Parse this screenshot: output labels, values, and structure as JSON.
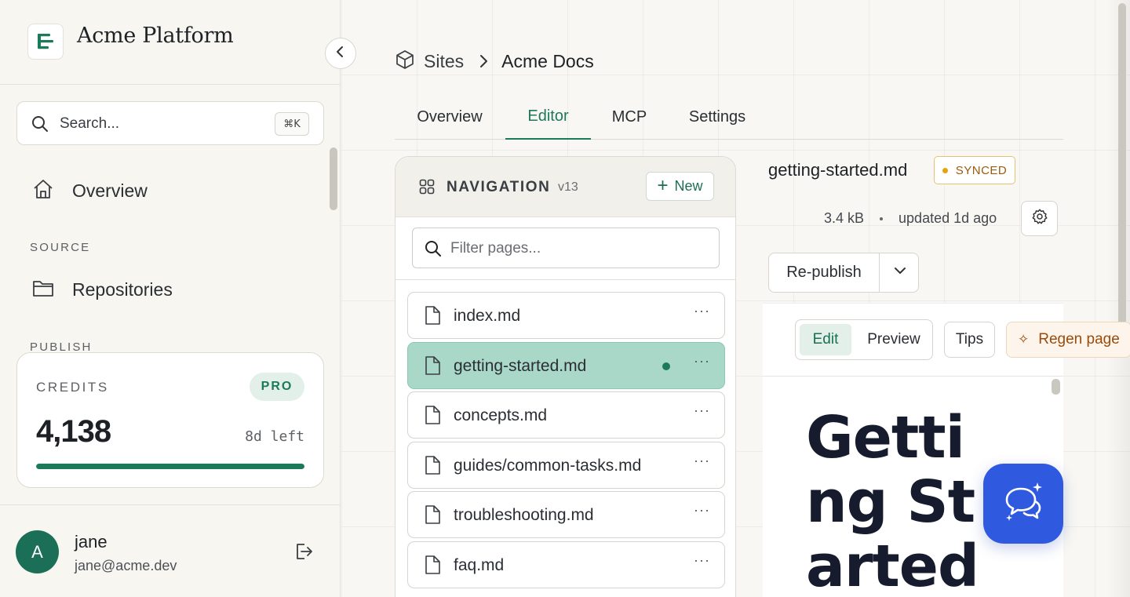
{
  "brand": {
    "title": "Acme Platform"
  },
  "sidebar": {
    "search": {
      "placeholder": "Search...",
      "shortcut": "⌘K"
    },
    "items": [
      {
        "label": "Overview",
        "icon": "home-icon"
      },
      {
        "label": "Repositories",
        "icon": "folder-icon"
      }
    ],
    "sections": {
      "source": "SOURCE",
      "publish": "PUBLISH"
    },
    "credits": {
      "label": "CREDITS",
      "plan": "PRO",
      "amount": "4,138",
      "remaining": "8d left",
      "progress": 1.0
    },
    "user": {
      "initial": "A",
      "name": "jane",
      "email": "jane@acme.dev"
    }
  },
  "breadcrumb": {
    "parent": "Sites",
    "current": "Acme Docs"
  },
  "tabs": [
    {
      "label": "Overview"
    },
    {
      "label": "Editor",
      "active": true
    },
    {
      "label": "MCP"
    },
    {
      "label": "Settings"
    }
  ],
  "navigation": {
    "title": "NAVIGATION",
    "version": "v13",
    "new_label": "New",
    "filter_placeholder": "Filter pages...",
    "files": [
      {
        "name": "index.md"
      },
      {
        "name": "getting-started.md",
        "active": true,
        "modified": true
      },
      {
        "name": "concepts.md"
      },
      {
        "name": "guides/common-tasks.md"
      },
      {
        "name": "troubleshooting.md"
      },
      {
        "name": "faq.md"
      }
    ]
  },
  "document": {
    "name": "getting-started.md",
    "status": "SYNCED",
    "size": "3.4 kB",
    "updated": "updated 1d ago",
    "republish_label": "Re-publish",
    "toolbar": {
      "edit": "Edit",
      "preview": "Preview",
      "tips": "Tips",
      "regen": "Regen page"
    },
    "heading": "Getting Started"
  },
  "colors": {
    "accent": "#1b7a5a",
    "active_row": "#a9d8c8",
    "synced": "#e6a40b",
    "chat": "#2f5ae0"
  }
}
